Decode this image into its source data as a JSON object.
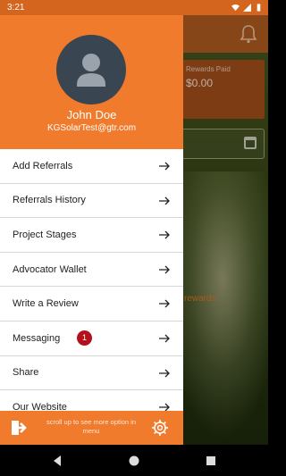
{
  "status_bar": {
    "time": "3:21"
  },
  "background": {
    "rewards_paid_label": "Rewards Paid",
    "rewards_paid_value": "$0.00",
    "partial_text": "rewards."
  },
  "drawer": {
    "user_name": "John Doe",
    "user_email": "KGSolarTest@gtr.com",
    "menu": [
      {
        "label": "Add Referrals"
      },
      {
        "label": "Referrals History"
      },
      {
        "label": "Project Stages"
      },
      {
        "label": "Advocator Wallet"
      },
      {
        "label": "Write a Review"
      },
      {
        "label": "Messaging",
        "badge": "1"
      },
      {
        "label": "Share"
      },
      {
        "label": "Our Website"
      }
    ],
    "footer_note": "scroll up to see more option in menu"
  },
  "colors": {
    "accent": "#f07b2d",
    "badge": "#b3121d",
    "status_bar": "#d4651f"
  },
  "icons": {
    "avatar": "user-silhouette-icon",
    "arrow": "arrow-right-icon",
    "logout": "logout-icon",
    "settings": "gear-icon",
    "notification": "bell-icon",
    "calendar": "calendar-icon"
  }
}
